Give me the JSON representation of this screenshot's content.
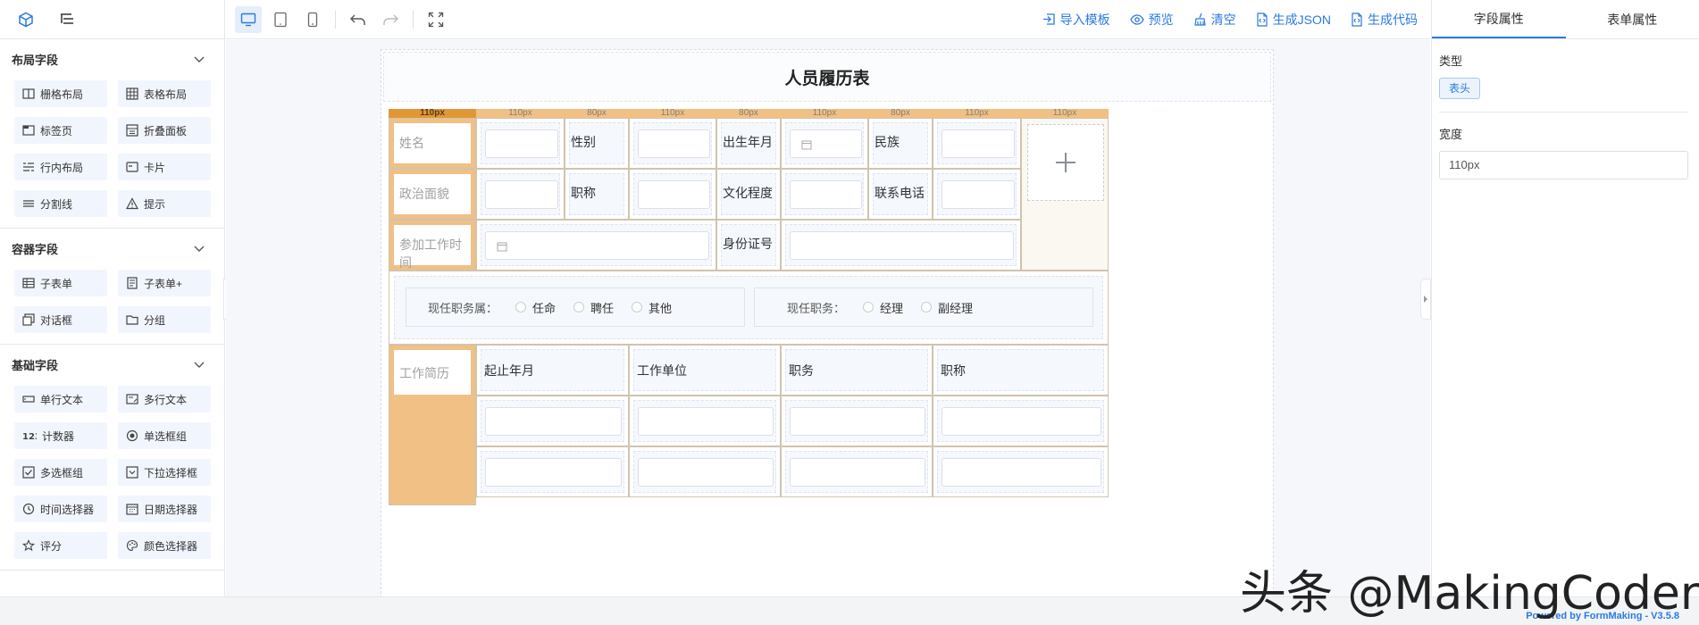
{
  "left_panel": {
    "sections": [
      {
        "title": "布局字段",
        "items": [
          {
            "label": "栅格布局",
            "icon": "grid-layout-icon"
          },
          {
            "label": "表格布局",
            "icon": "table-layout-icon"
          },
          {
            "label": "标签页",
            "icon": "tabs-icon"
          },
          {
            "label": "折叠面板",
            "icon": "collapse-icon"
          },
          {
            "label": "行内布局",
            "icon": "inline-layout-icon"
          },
          {
            "label": "卡片",
            "icon": "card-icon"
          },
          {
            "label": "分割线",
            "icon": "divider-icon"
          },
          {
            "label": "提示",
            "icon": "alert-icon"
          }
        ]
      },
      {
        "title": "容器字段",
        "items": [
          {
            "label": "子表单",
            "icon": "subform-icon"
          },
          {
            "label": "子表单+",
            "icon": "subform-plus-icon"
          },
          {
            "label": "对话框",
            "icon": "dialog-icon"
          },
          {
            "label": "分组",
            "icon": "folder-icon"
          }
        ]
      },
      {
        "title": "基础字段",
        "items": [
          {
            "label": "单行文本",
            "icon": "input-icon"
          },
          {
            "label": "多行文本",
            "icon": "textarea-icon"
          },
          {
            "label": "计数器",
            "icon": "number-icon"
          },
          {
            "label": "单选框组",
            "icon": "radio-icon"
          },
          {
            "label": "多选框组",
            "icon": "checkbox-icon"
          },
          {
            "label": "下拉选择框",
            "icon": "select-icon"
          },
          {
            "label": "时间选择器",
            "icon": "clock-icon"
          },
          {
            "label": "日期选择器",
            "icon": "calendar-icon"
          },
          {
            "label": "评分",
            "icon": "star-icon"
          },
          {
            "label": "颜色选择器",
            "icon": "palette-icon"
          }
        ]
      }
    ]
  },
  "toolbar": {
    "actions": [
      {
        "label": "导入模板",
        "icon": "import-icon"
      },
      {
        "label": "预览",
        "icon": "eye-icon"
      },
      {
        "label": "清空",
        "icon": "broom-icon"
      },
      {
        "label": "生成JSON",
        "icon": "json-file-icon"
      },
      {
        "label": "生成代码",
        "icon": "code-file-icon"
      }
    ]
  },
  "form": {
    "title": "人员履历表",
    "column_widths": [
      "110px",
      "110px",
      "80px",
      "110px",
      "80px",
      "110px",
      "80px",
      "110px",
      "110px"
    ],
    "selected_column": 0,
    "rows": {
      "r1": {
        "header": "姓名",
        "l2": "性别",
        "l4": "出生年月",
        "l6": "民族"
      },
      "r2": {
        "header": "政治面貌",
        "l2": "职称",
        "l4": "文化程度",
        "l6": "联系电话"
      },
      "r3": {
        "header": "参加工作时间",
        "l4": "身份证号"
      }
    },
    "radio_group_1": {
      "label": "现任职务属：",
      "options": [
        "任命",
        "聘任",
        "其他"
      ]
    },
    "radio_group_2": {
      "label": "现任职务：",
      "options": [
        "经理",
        "副经理"
      ]
    },
    "work_history": {
      "header": "工作简历",
      "columns": [
        "起止年月",
        "工作单位",
        "职务",
        "职称"
      ]
    }
  },
  "right_panel": {
    "tabs": [
      "字段属性",
      "表单属性"
    ],
    "active_tab": 0,
    "type_label": "类型",
    "type_value": "表头",
    "width_label": "宽度",
    "width_value": "110px"
  },
  "footer": {
    "powered": "Powered by FormMaking - V3.5.8"
  },
  "watermark": "头条 @MakingCoder",
  "colors": {
    "accent": "#2a7ae2",
    "header_orange": "#f0c085",
    "selected_orange": "#e09837"
  }
}
